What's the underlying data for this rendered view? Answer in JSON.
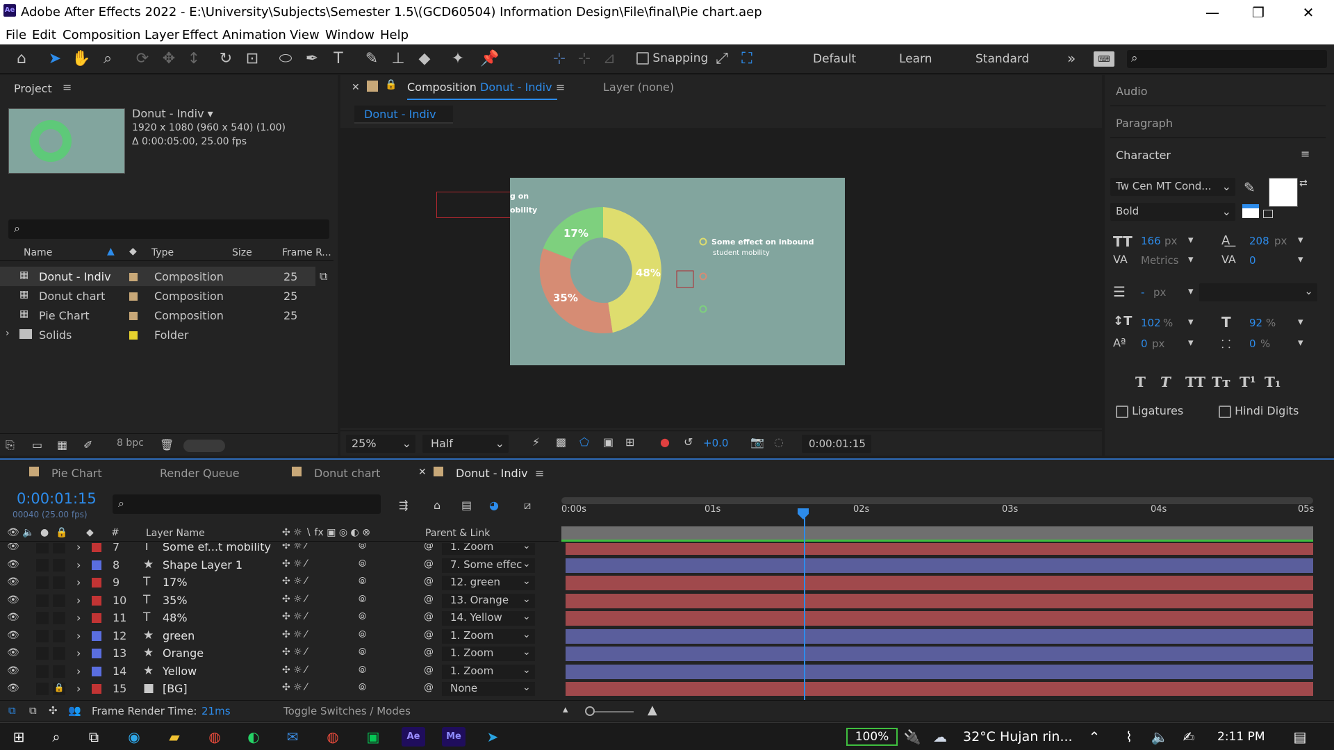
{
  "window": {
    "title": "Adobe After Effects 2022 - E:\\University\\Subjects\\Semester 1.5\\(GCD60504) Information Design\\File\\final\\Pie chart.aep",
    "app_icon": "Ae"
  },
  "menu": [
    "File",
    "Edit",
    "Composition",
    "Layer",
    "Effect",
    "Animation",
    "View",
    "Window",
    "Help"
  ],
  "toolbar": {
    "snapping": "Snapping",
    "workspaces": [
      "Default",
      "Learn",
      "Standard"
    ]
  },
  "project": {
    "panel_label": "Project",
    "comp_name": "Donut - Indiv",
    "comp_res": "1920 x 1080  (960 x 540) (1.00)",
    "comp_dur": "Δ 0:00:05:00, 25.00 fps",
    "columns": [
      "Name",
      "Type",
      "Size",
      "Frame R..."
    ],
    "items": [
      {
        "name": "Donut - Indiv",
        "type": "Composition",
        "fr": "25"
      },
      {
        "name": "Donut chart",
        "type": "Composition",
        "fr": "25"
      },
      {
        "name": "Pie Chart",
        "type": "Composition",
        "fr": "25"
      },
      {
        "name": "Solids",
        "type": "Folder",
        "fr": ""
      }
    ],
    "bpc": "8 bpc"
  },
  "viewer": {
    "tab_prefix": "Composition",
    "tab_name": "Donut - Indiv",
    "layer_tab": "Layer (none)",
    "breadcrumb": "Donut - Indiv",
    "zoom": "25%",
    "quality": "Half",
    "exposure": "+0.0",
    "timecode": "0:00:01:15",
    "art": {
      "frag1": "g on",
      "frag2": "obility",
      "p17": "17%",
      "p48": "48%",
      "p35": "35%",
      "legend1": "Some effect on inbound",
      "legend2": "student mobility"
    }
  },
  "panels": {
    "audio": "Audio",
    "paragraph": "Paragraph",
    "character": "Character",
    "font": "Tw Cen MT Cond...",
    "style": "Bold",
    "size": "166",
    "size_unit": "px",
    "leading": "208",
    "leading_unit": "px",
    "kerning": "Metrics",
    "tracking": "0",
    "stroke": "-",
    "stroke_unit": "px",
    "vscale": "102",
    "vscale_unit": "%",
    "hscale": "92",
    "hscale_unit": "%",
    "baseline": "0",
    "baseline_unit": "px",
    "tsume": "0",
    "tsume_unit": "%",
    "ligatures": "Ligatures",
    "hindi": "Hindi Digits"
  },
  "timeline": {
    "tabs": [
      "Pie Chart",
      "Render Queue",
      "Donut chart",
      "Donut - Indiv"
    ],
    "timecode": "0:00:01:15",
    "frames": "00040 (25.00 fps)",
    "ruler": [
      "0:00s",
      "01s",
      "02s",
      "03s",
      "04s",
      "05s"
    ],
    "col_layer": "Layer Name",
    "col_parent": "Parent & Link",
    "layers": [
      {
        "num": "7",
        "kind": "T",
        "name": "Some ef...t mobility",
        "parent": "1. Zoom",
        "color": "#c23434",
        "bar": "red"
      },
      {
        "num": "8",
        "kind": "★",
        "name": "Shape Layer 1",
        "parent": "7. Some effec",
        "color": "#5a6ee0",
        "bar": "blue"
      },
      {
        "num": "9",
        "kind": "T",
        "name": "17%",
        "parent": "12. green",
        "color": "#c23434",
        "bar": "red"
      },
      {
        "num": "10",
        "kind": "T",
        "name": "35%",
        "parent": "13. Orange",
        "color": "#c23434",
        "bar": "red"
      },
      {
        "num": "11",
        "kind": "T",
        "name": "48%",
        "parent": "14. Yellow",
        "color": "#c23434",
        "bar": "red"
      },
      {
        "num": "12",
        "kind": "★",
        "name": "green",
        "parent": "1. Zoom",
        "color": "#5a6ee0",
        "bar": "blue"
      },
      {
        "num": "13",
        "kind": "★",
        "name": "Orange",
        "parent": "1. Zoom",
        "color": "#5a6ee0",
        "bar": "blue"
      },
      {
        "num": "14",
        "kind": "★",
        "name": "Yellow",
        "parent": "1. Zoom",
        "color": "#5a6ee0",
        "bar": "blue"
      },
      {
        "num": "15",
        "kind": "■",
        "name": "[BG]",
        "parent": "None",
        "color": "#c23434",
        "bar": "red"
      }
    ],
    "render_label": "Frame Render Time:",
    "render_time": "21ms",
    "toggle": "Toggle Switches / Modes"
  },
  "taskbar": {
    "battery": "100%",
    "weather": "32°C  Hujan rin...",
    "time": "2:11 PM"
  }
}
